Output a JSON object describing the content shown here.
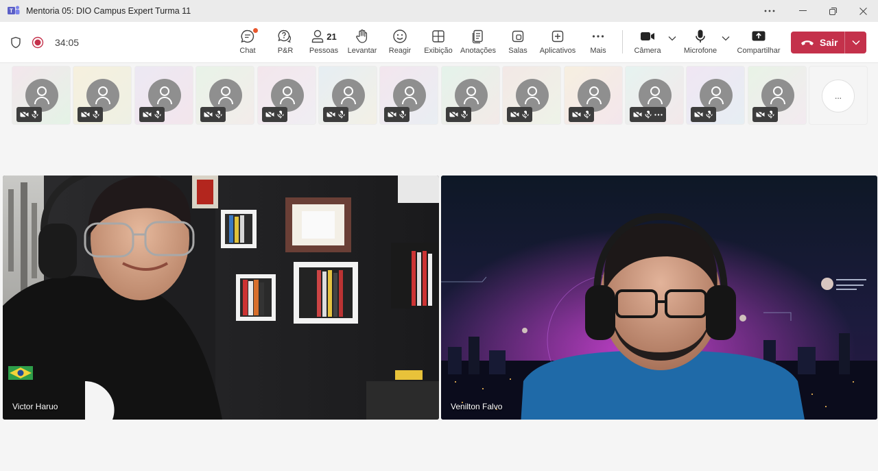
{
  "window": {
    "title": "Mentoria 05: DIO Campus Expert Turma 11"
  },
  "meeting": {
    "timer": "34:05"
  },
  "toolbar": {
    "chat": "Chat",
    "qa": "P&R",
    "people": "Pessoas",
    "people_count": "21",
    "raise": "Levantar",
    "react": "Reagir",
    "view": "Exibição",
    "notes": "Anotações",
    "rooms": "Salas",
    "apps": "Aplicativos",
    "more": "Mais",
    "camera": "Câmera",
    "mic": "Microfone",
    "share": "Compartilhar",
    "leave": "Sair"
  },
  "strip": {
    "more_label": "...",
    "tile_count": 13
  },
  "videos": [
    {
      "name": "Victor Haruo"
    },
    {
      "name": "Venilton Falvo"
    }
  ],
  "colors": {
    "leave": "#c4314b",
    "badge": "#e8572d",
    "teams_purple": "#5b5fc7"
  }
}
